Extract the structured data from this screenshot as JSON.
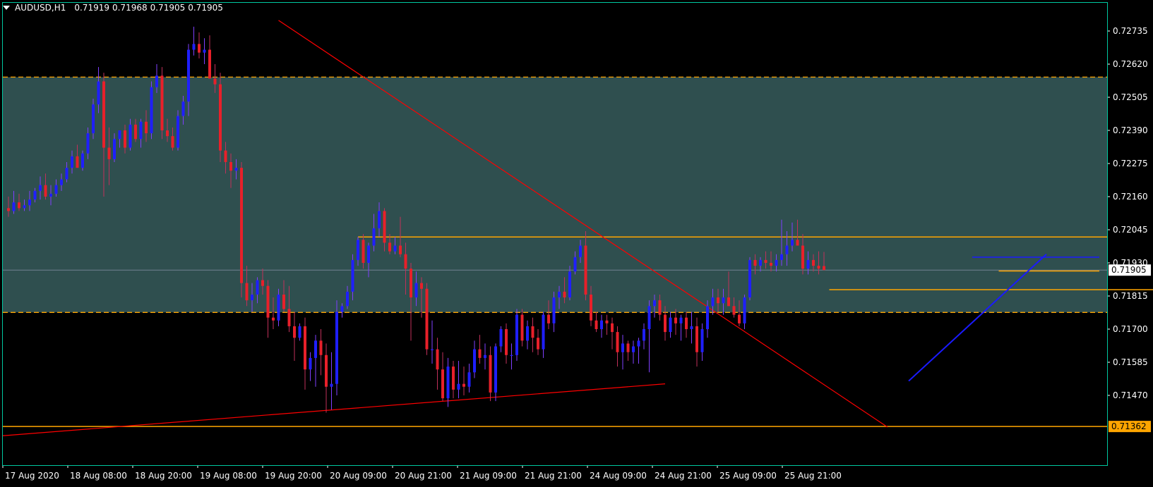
{
  "header": {
    "symbol": "AUDUSD,H1",
    "open": "0.71919",
    "high": "0.71968",
    "low": "0.71905",
    "close": "0.71905"
  },
  "colors": {
    "background": "#000000",
    "frame": "#00c8a0",
    "zone_fill": "#2f4f4f",
    "bull": "#1f1fff",
    "bear": "#e8202a",
    "orange": "#ffa500",
    "trend_red": "#ff0000",
    "trend_blue": "#1a1aff",
    "text": "#ffffff"
  },
  "chart_data": {
    "type": "candlestick",
    "symbol": "AUDUSD",
    "timeframe": "H1",
    "ylim": [
      0.7132,
      0.7282
    ],
    "y_ticks": [
      "0.72735",
      "0.72620",
      "0.72505",
      "0.72390",
      "0.72275",
      "0.72160",
      "0.72045",
      "0.71930",
      "0.71815",
      "0.71700",
      "0.71585",
      "0.71470"
    ],
    "x_ticks": [
      "17 Aug 2020",
      "18 Aug 08:00",
      "18 Aug 20:00",
      "19 Aug 08:00",
      "19 Aug 20:00",
      "20 Aug 09:00",
      "20 Aug 21:00",
      "21 Aug 09:00",
      "21 Aug 21:00",
      "24 Aug 09:00",
      "24 Aug 21:00",
      "25 Aug 09:00",
      "25 Aug 21:00"
    ],
    "current_price": "0.71905",
    "level_label": "0.71362",
    "zone": {
      "top": 0.72575,
      "bottom": 0.71758
    },
    "horizontal_levels": [
      {
        "price": 0.7202,
        "from": 66,
        "to": "end",
        "color": "orange"
      },
      {
        "price": 0.71837,
        "from": 155,
        "to": 230,
        "color": "orange"
      },
      {
        "price": 0.71902,
        "from": 187,
        "to": 206,
        "color": "orange"
      },
      {
        "price": 0.7195,
        "from": 182,
        "to": 206,
        "color": "blue"
      },
      {
        "price": 0.71362,
        "from": 0,
        "to": "end",
        "color": "orange"
      }
    ],
    "trendlines": [
      {
        "from": [
          0,
          0.7133
        ],
        "to": [
          124,
          0.7151
        ],
        "color": "red"
      },
      {
        "from": [
          51,
          0.72772
        ],
        "to": [
          166,
          0.7136
        ],
        "color": "red"
      },
      {
        "from": [
          170,
          0.7152
        ],
        "to": [
          196,
          0.7196
        ],
        "color": "blue"
      }
    ],
    "candles": [
      {
        "o": 0.7212,
        "h": 0.7216,
        "l": 0.7209,
        "c": 0.7211
      },
      {
        "o": 0.7211,
        "h": 0.7218,
        "l": 0.721,
        "c": 0.7214
      },
      {
        "o": 0.7214,
        "h": 0.7217,
        "l": 0.7211,
        "c": 0.7212
      },
      {
        "o": 0.7212,
        "h": 0.7215,
        "l": 0.7211,
        "c": 0.7213
      },
      {
        "o": 0.7213,
        "h": 0.7218,
        "l": 0.7211,
        "c": 0.7215
      },
      {
        "o": 0.7215,
        "h": 0.7219,
        "l": 0.7214,
        "c": 0.7218
      },
      {
        "o": 0.7218,
        "h": 0.7223,
        "l": 0.7215,
        "c": 0.722
      },
      {
        "o": 0.722,
        "h": 0.7224,
        "l": 0.7215,
        "c": 0.7216
      },
      {
        "o": 0.7216,
        "h": 0.722,
        "l": 0.7213,
        "c": 0.7217
      },
      {
        "o": 0.7217,
        "h": 0.7222,
        "l": 0.7216,
        "c": 0.722
      },
      {
        "o": 0.722,
        "h": 0.7224,
        "l": 0.7218,
        "c": 0.7222
      },
      {
        "o": 0.7222,
        "h": 0.7228,
        "l": 0.7221,
        "c": 0.7226
      },
      {
        "o": 0.7226,
        "h": 0.7232,
        "l": 0.7224,
        "c": 0.723
      },
      {
        "o": 0.723,
        "h": 0.7234,
        "l": 0.7226,
        "c": 0.7226
      },
      {
        "o": 0.7226,
        "h": 0.7232,
        "l": 0.7225,
        "c": 0.7231
      },
      {
        "o": 0.7231,
        "h": 0.724,
        "l": 0.7229,
        "c": 0.7238
      },
      {
        "o": 0.7238,
        "h": 0.725,
        "l": 0.7236,
        "c": 0.7248
      },
      {
        "o": 0.7248,
        "h": 0.7261,
        "l": 0.7245,
        "c": 0.7256
      },
      {
        "o": 0.7256,
        "h": 0.7259,
        "l": 0.7216,
        "c": 0.7233
      },
      {
        "o": 0.7233,
        "h": 0.724,
        "l": 0.722,
        "c": 0.7229
      },
      {
        "o": 0.7229,
        "h": 0.7238,
        "l": 0.7228,
        "c": 0.7236
      },
      {
        "o": 0.7236,
        "h": 0.7239,
        "l": 0.7233,
        "c": 0.7239
      },
      {
        "o": 0.7239,
        "h": 0.7241,
        "l": 0.7231,
        "c": 0.7233
      },
      {
        "o": 0.7233,
        "h": 0.7243,
        "l": 0.7232,
        "c": 0.7241
      },
      {
        "o": 0.7241,
        "h": 0.7243,
        "l": 0.7235,
        "c": 0.7236
      },
      {
        "o": 0.7236,
        "h": 0.7243,
        "l": 0.7233,
        "c": 0.7242
      },
      {
        "o": 0.7242,
        "h": 0.7246,
        "l": 0.7235,
        "c": 0.7238
      },
      {
        "o": 0.7238,
        "h": 0.7256,
        "l": 0.7236,
        "c": 0.7254
      },
      {
        "o": 0.7254,
        "h": 0.7262,
        "l": 0.7252,
        "c": 0.7258
      },
      {
        "o": 0.7258,
        "h": 0.7261,
        "l": 0.7236,
        "c": 0.7239
      },
      {
        "o": 0.7239,
        "h": 0.7243,
        "l": 0.7235,
        "c": 0.7237
      },
      {
        "o": 0.7237,
        "h": 0.724,
        "l": 0.7232,
        "c": 0.7233
      },
      {
        "o": 0.7233,
        "h": 0.7246,
        "l": 0.7232,
        "c": 0.7244
      },
      {
        "o": 0.7244,
        "h": 0.7251,
        "l": 0.7241,
        "c": 0.7249
      },
      {
        "o": 0.7249,
        "h": 0.7269,
        "l": 0.7244,
        "c": 0.7267
      },
      {
        "o": 0.7267,
        "h": 0.7275,
        "l": 0.7265,
        "c": 0.7269
      },
      {
        "o": 0.7269,
        "h": 0.7273,
        "l": 0.7264,
        "c": 0.7266
      },
      {
        "o": 0.7266,
        "h": 0.7271,
        "l": 0.7262,
        "c": 0.7267
      },
      {
        "o": 0.7267,
        "h": 0.7272,
        "l": 0.7259,
        "c": 0.7257
      },
      {
        "o": 0.7257,
        "h": 0.7262,
        "l": 0.7252,
        "c": 0.7255
      },
      {
        "o": 0.7255,
        "h": 0.7259,
        "l": 0.7228,
        "c": 0.7232
      },
      {
        "o": 0.7232,
        "h": 0.7235,
        "l": 0.7224,
        "c": 0.7228
      },
      {
        "o": 0.7228,
        "h": 0.7231,
        "l": 0.7219,
        "c": 0.7225
      },
      {
        "o": 0.7225,
        "h": 0.7229,
        "l": 0.7222,
        "c": 0.7226
      },
      {
        "o": 0.7226,
        "h": 0.7228,
        "l": 0.7181,
        "c": 0.7186
      },
      {
        "o": 0.7186,
        "h": 0.7192,
        "l": 0.7178,
        "c": 0.718
      },
      {
        "o": 0.718,
        "h": 0.7186,
        "l": 0.7176,
        "c": 0.7182
      },
      {
        "o": 0.7182,
        "h": 0.7188,
        "l": 0.7179,
        "c": 0.7187
      },
      {
        "o": 0.7187,
        "h": 0.7191,
        "l": 0.7182,
        "c": 0.7185
      },
      {
        "o": 0.7185,
        "h": 0.7187,
        "l": 0.7167,
        "c": 0.7174
      },
      {
        "o": 0.7174,
        "h": 0.7181,
        "l": 0.717,
        "c": 0.7173
      },
      {
        "o": 0.7173,
        "h": 0.7184,
        "l": 0.7171,
        "c": 0.7182
      },
      {
        "o": 0.7182,
        "h": 0.7187,
        "l": 0.7176,
        "c": 0.7177
      },
      {
        "o": 0.7177,
        "h": 0.7185,
        "l": 0.7169,
        "c": 0.7171
      },
      {
        "o": 0.7171,
        "h": 0.7176,
        "l": 0.7159,
        "c": 0.7167
      },
      {
        "o": 0.7167,
        "h": 0.7172,
        "l": 0.7166,
        "c": 0.7171
      },
      {
        "o": 0.7171,
        "h": 0.7174,
        "l": 0.7149,
        "c": 0.7156
      },
      {
        "o": 0.7156,
        "h": 0.7162,
        "l": 0.7152,
        "c": 0.716
      },
      {
        "o": 0.716,
        "h": 0.7168,
        "l": 0.715,
        "c": 0.7166
      },
      {
        "o": 0.7166,
        "h": 0.717,
        "l": 0.7154,
        "c": 0.7161
      },
      {
        "o": 0.7161,
        "h": 0.7165,
        "l": 0.7141,
        "c": 0.715
      },
      {
        "o": 0.715,
        "h": 0.7162,
        "l": 0.7142,
        "c": 0.7151
      },
      {
        "o": 0.7151,
        "h": 0.718,
        "l": 0.7147,
        "c": 0.7176
      },
      {
        "o": 0.7176,
        "h": 0.7179,
        "l": 0.7174,
        "c": 0.7178
      },
      {
        "o": 0.7178,
        "h": 0.7185,
        "l": 0.7177,
        "c": 0.7183
      },
      {
        "o": 0.7183,
        "h": 0.7196,
        "l": 0.718,
        "c": 0.7194
      },
      {
        "o": 0.7194,
        "h": 0.7202,
        "l": 0.7192,
        "c": 0.7201
      },
      {
        "o": 0.7201,
        "h": 0.7203,
        "l": 0.7191,
        "c": 0.7193
      },
      {
        "o": 0.7193,
        "h": 0.72,
        "l": 0.7188,
        "c": 0.7199
      },
      {
        "o": 0.7199,
        "h": 0.721,
        "l": 0.7197,
        "c": 0.7205
      },
      {
        "o": 0.7205,
        "h": 0.7214,
        "l": 0.7202,
        "c": 0.7211
      },
      {
        "o": 0.7211,
        "h": 0.7212,
        "l": 0.7197,
        "c": 0.72
      },
      {
        "o": 0.72,
        "h": 0.7203,
        "l": 0.7196,
        "c": 0.7197
      },
      {
        "o": 0.7197,
        "h": 0.7202,
        "l": 0.7196,
        "c": 0.7199
      },
      {
        "o": 0.7199,
        "h": 0.7209,
        "l": 0.7195,
        "c": 0.7196
      },
      {
        "o": 0.7196,
        "h": 0.72,
        "l": 0.7182,
        "c": 0.7191
      },
      {
        "o": 0.7191,
        "h": 0.7193,
        "l": 0.7166,
        "c": 0.7181
      },
      {
        "o": 0.7181,
        "h": 0.719,
        "l": 0.7178,
        "c": 0.7186
      },
      {
        "o": 0.7186,
        "h": 0.7188,
        "l": 0.7174,
        "c": 0.7184
      },
      {
        "o": 0.7184,
        "h": 0.7186,
        "l": 0.7161,
        "c": 0.7163
      },
      {
        "o": 0.7163,
        "h": 0.7173,
        "l": 0.7158,
        "c": 0.7163
      },
      {
        "o": 0.7163,
        "h": 0.7167,
        "l": 0.7149,
        "c": 0.7156
      },
      {
        "o": 0.7156,
        "h": 0.7162,
        "l": 0.7145,
        "c": 0.7146
      },
      {
        "o": 0.7146,
        "h": 0.716,
        "l": 0.7143,
        "c": 0.7157
      },
      {
        "o": 0.7157,
        "h": 0.7159,
        "l": 0.7146,
        "c": 0.7149
      },
      {
        "o": 0.7149,
        "h": 0.7159,
        "l": 0.7146,
        "c": 0.7151
      },
      {
        "o": 0.7151,
        "h": 0.7157,
        "l": 0.7147,
        "c": 0.715
      },
      {
        "o": 0.715,
        "h": 0.7158,
        "l": 0.7148,
        "c": 0.7155
      },
      {
        "o": 0.7155,
        "h": 0.7166,
        "l": 0.7153,
        "c": 0.7163
      },
      {
        "o": 0.7163,
        "h": 0.7168,
        "l": 0.7158,
        "c": 0.716
      },
      {
        "o": 0.716,
        "h": 0.7165,
        "l": 0.7156,
        "c": 0.7161
      },
      {
        "o": 0.7161,
        "h": 0.7164,
        "l": 0.7145,
        "c": 0.7148
      },
      {
        "o": 0.7148,
        "h": 0.7165,
        "l": 0.7145,
        "c": 0.7164
      },
      {
        "o": 0.7164,
        "h": 0.7171,
        "l": 0.7162,
        "c": 0.717
      },
      {
        "o": 0.717,
        "h": 0.7172,
        "l": 0.7158,
        "c": 0.7161
      },
      {
        "o": 0.7161,
        "h": 0.7165,
        "l": 0.7156,
        "c": 0.7161
      },
      {
        "o": 0.7161,
        "h": 0.7177,
        "l": 0.7159,
        "c": 0.7175
      },
      {
        "o": 0.7175,
        "h": 0.7177,
        "l": 0.7164,
        "c": 0.7166
      },
      {
        "o": 0.7166,
        "h": 0.7173,
        "l": 0.7163,
        "c": 0.7171
      },
      {
        "o": 0.7171,
        "h": 0.7174,
        "l": 0.7162,
        "c": 0.7167
      },
      {
        "o": 0.7167,
        "h": 0.717,
        "l": 0.7161,
        "c": 0.7163
      },
      {
        "o": 0.7163,
        "h": 0.7176,
        "l": 0.716,
        "c": 0.7175
      },
      {
        "o": 0.7175,
        "h": 0.718,
        "l": 0.717,
        "c": 0.7172
      },
      {
        "o": 0.7172,
        "h": 0.7183,
        "l": 0.7169,
        "c": 0.7181
      },
      {
        "o": 0.7181,
        "h": 0.7185,
        "l": 0.7177,
        "c": 0.7183
      },
      {
        "o": 0.7183,
        "h": 0.7188,
        "l": 0.7179,
        "c": 0.7181
      },
      {
        "o": 0.7181,
        "h": 0.7192,
        "l": 0.718,
        "c": 0.719
      },
      {
        "o": 0.719,
        "h": 0.7197,
        "l": 0.7189,
        "c": 0.7195
      },
      {
        "o": 0.7195,
        "h": 0.7201,
        "l": 0.7193,
        "c": 0.7199
      },
      {
        "o": 0.7199,
        "h": 0.7204,
        "l": 0.718,
        "c": 0.7182
      },
      {
        "o": 0.7182,
        "h": 0.7185,
        "l": 0.7171,
        "c": 0.7173
      },
      {
        "o": 0.7173,
        "h": 0.7176,
        "l": 0.7169,
        "c": 0.717
      },
      {
        "o": 0.717,
        "h": 0.7175,
        "l": 0.7167,
        "c": 0.7173
      },
      {
        "o": 0.7173,
        "h": 0.7175,
        "l": 0.7168,
        "c": 0.7172
      },
      {
        "o": 0.7172,
        "h": 0.7174,
        "l": 0.7163,
        "c": 0.7169
      },
      {
        "o": 0.7169,
        "h": 0.7171,
        "l": 0.7157,
        "c": 0.7162
      },
      {
        "o": 0.7162,
        "h": 0.7168,
        "l": 0.7156,
        "c": 0.7165
      },
      {
        "o": 0.7165,
        "h": 0.7166,
        "l": 0.7159,
        "c": 0.7162
      },
      {
        "o": 0.7162,
        "h": 0.7166,
        "l": 0.7158,
        "c": 0.7164
      },
      {
        "o": 0.7164,
        "h": 0.7167,
        "l": 0.7158,
        "c": 0.7166
      },
      {
        "o": 0.7166,
        "h": 0.7172,
        "l": 0.7163,
        "c": 0.717
      },
      {
        "o": 0.717,
        "h": 0.718,
        "l": 0.7155,
        "c": 0.7178
      },
      {
        "o": 0.7178,
        "h": 0.7182,
        "l": 0.7174,
        "c": 0.718
      },
      {
        "o": 0.718,
        "h": 0.7182,
        "l": 0.7173,
        "c": 0.7175
      },
      {
        "o": 0.7175,
        "h": 0.7178,
        "l": 0.7166,
        "c": 0.7169
      },
      {
        "o": 0.7169,
        "h": 0.7176,
        "l": 0.7167,
        "c": 0.7174
      },
      {
        "o": 0.7174,
        "h": 0.7177,
        "l": 0.7168,
        "c": 0.7172
      },
      {
        "o": 0.7172,
        "h": 0.7175,
        "l": 0.7166,
        "c": 0.7174
      },
      {
        "o": 0.7174,
        "h": 0.7176,
        "l": 0.7167,
        "c": 0.717
      },
      {
        "o": 0.717,
        "h": 0.7176,
        "l": 0.7165,
        "c": 0.7171
      },
      {
        "o": 0.7171,
        "h": 0.7174,
        "l": 0.7157,
        "c": 0.7162
      },
      {
        "o": 0.7162,
        "h": 0.7172,
        "l": 0.7159,
        "c": 0.717
      },
      {
        "o": 0.717,
        "h": 0.718,
        "l": 0.7167,
        "c": 0.7178
      },
      {
        "o": 0.7178,
        "h": 0.7184,
        "l": 0.7175,
        "c": 0.7181
      },
      {
        "o": 0.7181,
        "h": 0.7184,
        "l": 0.7176,
        "c": 0.7179
      },
      {
        "o": 0.7179,
        "h": 0.7184,
        "l": 0.7175,
        "c": 0.7181
      },
      {
        "o": 0.7181,
        "h": 0.719,
        "l": 0.7178,
        "c": 0.7178
      },
      {
        "o": 0.7178,
        "h": 0.7181,
        "l": 0.7174,
        "c": 0.7175
      },
      {
        "o": 0.7175,
        "h": 0.718,
        "l": 0.7171,
        "c": 0.7172
      },
      {
        "o": 0.7172,
        "h": 0.7182,
        "l": 0.717,
        "c": 0.7181
      },
      {
        "o": 0.7181,
        "h": 0.7195,
        "l": 0.718,
        "c": 0.7194
      },
      {
        "o": 0.7194,
        "h": 0.7196,
        "l": 0.7189,
        "c": 0.7192
      },
      {
        "o": 0.7192,
        "h": 0.7195,
        "l": 0.719,
        "c": 0.7194
      },
      {
        "o": 0.7194,
        "h": 0.7197,
        "l": 0.7191,
        "c": 0.7193
      },
      {
        "o": 0.7193,
        "h": 0.7197,
        "l": 0.719,
        "c": 0.7192
      },
      {
        "o": 0.7192,
        "h": 0.7196,
        "l": 0.719,
        "c": 0.7194
      },
      {
        "o": 0.7194,
        "h": 0.7208,
        "l": 0.7192,
        "c": 0.7196
      },
      {
        "o": 0.7196,
        "h": 0.7204,
        "l": 0.7192,
        "c": 0.7199
      },
      {
        "o": 0.7199,
        "h": 0.7207,
        "l": 0.7197,
        "c": 0.7201
      },
      {
        "o": 0.7201,
        "h": 0.7208,
        "l": 0.7199,
        "c": 0.7199
      },
      {
        "o": 0.7199,
        "h": 0.7203,
        "l": 0.7189,
        "c": 0.7191
      },
      {
        "o": 0.7191,
        "h": 0.7197,
        "l": 0.7189,
        "c": 0.7194
      },
      {
        "o": 0.7194,
        "h": 0.7196,
        "l": 0.719,
        "c": 0.7192
      },
      {
        "o": 0.7192,
        "h": 0.7197,
        "l": 0.7189,
        "c": 0.7191
      },
      {
        "o": 0.71919,
        "h": 0.71968,
        "l": 0.71905,
        "c": 0.71905
      }
    ]
  }
}
